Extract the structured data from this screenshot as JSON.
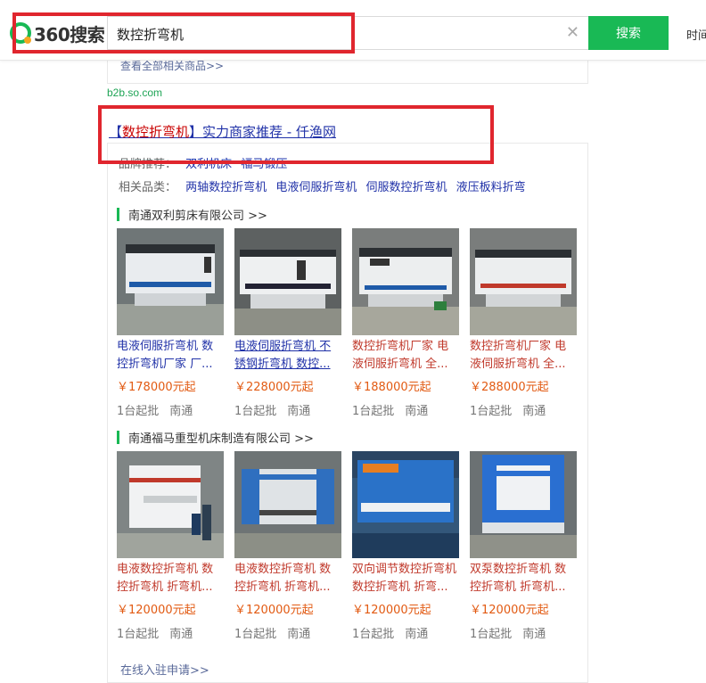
{
  "header": {
    "logo_text": "360搜索",
    "search_value": "数控折弯机",
    "search_button": "搜索",
    "right_link": "时间"
  },
  "prev_result": {
    "all_goods_link": "查看全部相关商品>>",
    "source_url": "b2b.so.com"
  },
  "result": {
    "title_open": "【",
    "title_em": "数控折弯机",
    "title_rest": "】实力商家推荐 - 仟渔网",
    "brand_label": "品牌推荐：",
    "brands": [
      "双利机床",
      "福马锻压"
    ],
    "related_label": "相关品类：",
    "related": [
      "两轴数控折弯机",
      "电液伺服折弯机",
      "伺服数控折弯机",
      "液压板料折弯机"
    ],
    "footer_link": "在线入驻申请>>"
  },
  "shops": [
    {
      "name": "南通双利剪床有限公司 >>",
      "products": [
        {
          "title": "电液伺服折弯机 数控折弯机厂家 厂...",
          "price": "￥178000元起",
          "moq": "1台起批",
          "city": "南通",
          "style": "blue-plain"
        },
        {
          "title": "电液伺服折弯机 不锈钢折弯机 数控...",
          "price": "￥228000元起",
          "moq": "1台起批",
          "city": "南通",
          "style": "blue-underline"
        },
        {
          "title": "数控折弯机厂家 电液伺服折弯机 全...",
          "price": "￥188000元起",
          "moq": "1台起批",
          "city": "南通",
          "style": "red"
        },
        {
          "title": "数控折弯机厂家 电液伺服折弯机 全...",
          "price": "￥288000元起",
          "moq": "1台起批",
          "city": "南通",
          "style": "red"
        }
      ]
    },
    {
      "name": "南通福马重型机床制造有限公司 >>",
      "products": [
        {
          "title": "电液数控折弯机 数控折弯机 折弯机...",
          "price": "￥120000元起",
          "moq": "1台起批",
          "city": "南通",
          "style": "red"
        },
        {
          "title": "电液数控折弯机 数控折弯机 折弯机...",
          "price": "￥120000元起",
          "moq": "1台起批",
          "city": "南通",
          "style": "red"
        },
        {
          "title": "双向调节数控折弯机 数控折弯机 折弯...",
          "price": "￥120000元起",
          "moq": "1台起批",
          "city": "南通",
          "style": "red"
        },
        {
          "title": "双泵数控折弯机 数控折弯机 折弯机...",
          "price": "￥120000元起",
          "moq": "1台起批",
          "city": "南通",
          "style": "red"
        }
      ]
    }
  ],
  "colors": {
    "accent_green": "#19b955",
    "highlight_red_box": "#e0262e",
    "link_blue": "#2132a8",
    "price_orange": "#e25a12"
  }
}
